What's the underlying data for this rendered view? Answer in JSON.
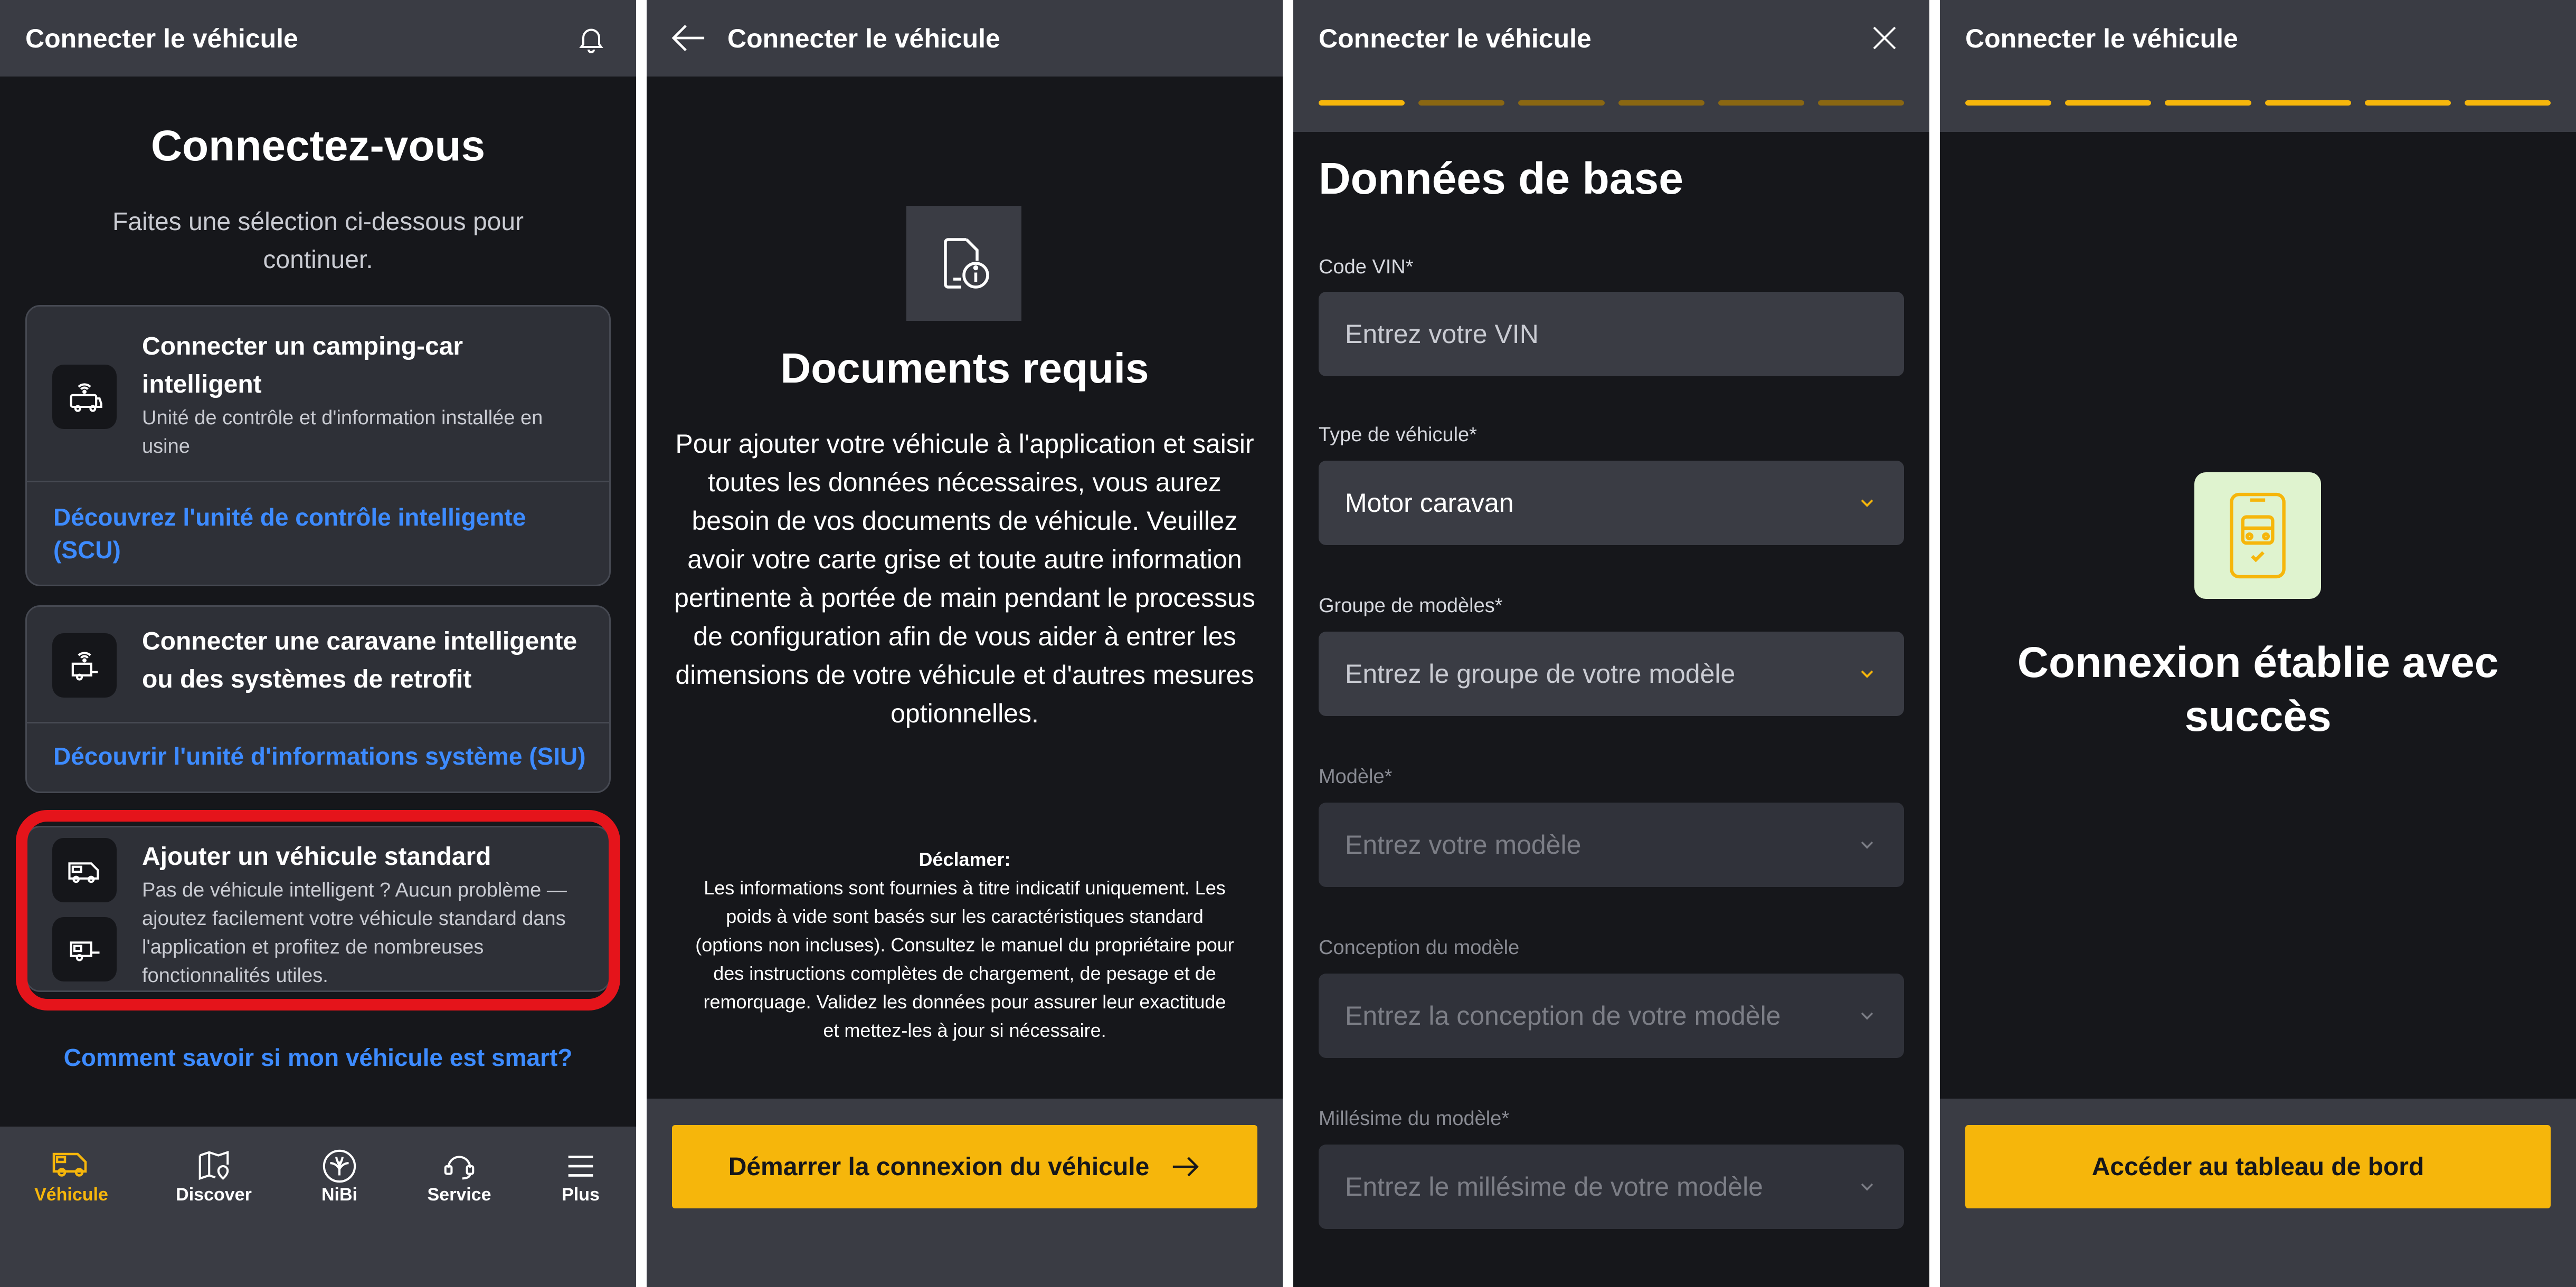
{
  "screen1": {
    "header_title": "Connecter le véhicule",
    "heading": "Connectez-vous",
    "subtitle": "Faites une sélection ci-dessous pour continuer.",
    "cards": [
      {
        "title": "Connecter un camping-car intelligent",
        "description": "Unité de contrôle et d'information installée en usine",
        "link": "Découvrez l'unité de contrôle intelligente (SCU)",
        "icon": "motorhome-signal-icon"
      },
      {
        "title": "Connecter une caravane intelligente ou des systèmes de retrofit",
        "link": "Découvrir l'unité d'informations système (SIU)",
        "icon": "caravan-signal-icon"
      },
      {
        "title": "Ajouter un véhicule standard",
        "description": "Pas de véhicule intelligent ? Aucun problème — ajoutez facilement votre véhicule standard dans l'application et profitez de nombreuses fonctionnalités utiles.",
        "icons": [
          "van-icon",
          "trailer-icon"
        ]
      }
    ],
    "help_link": "Comment savoir si mon véhicule est smart?",
    "nav": [
      {
        "label": "Véhicule",
        "icon": "van-icon",
        "active": true
      },
      {
        "label": "Discover",
        "icon": "map-pin-icon"
      },
      {
        "label": "NiBi",
        "icon": "nibi-logo-icon"
      },
      {
        "label": "Service",
        "icon": "headset-icon"
      },
      {
        "label": "Plus",
        "icon": "menu-icon"
      }
    ],
    "colors": {
      "accent": "#f6b60b",
      "link": "#3d8bff",
      "highlight": "#e5141b"
    }
  },
  "screen2": {
    "header_title": "Connecter le véhicule",
    "heading": "Documents requis",
    "body": "Pour ajouter votre véhicule à l'application et saisir toutes les données nécessaires, vous aurez besoin de vos documents de véhicule. Veuillez avoir votre carte grise et toute autre information pertinente à portée de main pendant le processus de configuration afin de vous aider à entrer les dimensions de votre véhicule et d'autres mesures optionnelles.",
    "disclaimer_title": "Déclamer:",
    "disclaimer_body": "Les informations sont fournies à titre indicatif uniquement. Les poids à vide sont basés sur les caractéristiques standard (options non incluses). Consultez le manuel du propriétaire pour des instructions complètes de chargement, de pesage et de remorquage. Validez les données pour assurer leur exactitude et mettez-les à jour si nécessaire.",
    "button": "Démarrer la connexion du véhicule"
  },
  "screen3": {
    "header_title": "Connecter le véhicule",
    "progress_total": 6,
    "progress_done": 1,
    "heading": "Données de base",
    "fields": [
      {
        "label": "Code VIN*",
        "placeholder": "Entrez votre VIN"
      },
      {
        "label": "Type de véhicule*",
        "value": "Motor caravan"
      },
      {
        "label": "Groupe de modèles*",
        "placeholder": "Entrez le groupe de votre modèle"
      },
      {
        "label": "Modèle*",
        "placeholder": "Entrez votre modèle"
      },
      {
        "label": "Conception du modèle",
        "placeholder": "Entrez la conception de votre modèle"
      },
      {
        "label": "Millésime du modèle*",
        "placeholder": "Entrez le millésime de votre modèle"
      }
    ]
  },
  "screen4": {
    "header_title": "Connecter le véhicule",
    "progress_total": 6,
    "progress_done": 6,
    "heading": "Connexion établie avec succès",
    "button": "Accéder au tableau de bord"
  }
}
